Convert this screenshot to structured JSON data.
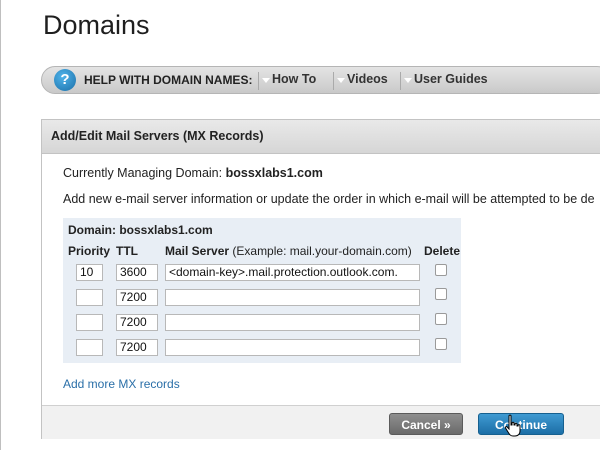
{
  "page": {
    "title": "Domains"
  },
  "help_bar": {
    "icon": "question-icon",
    "label": "HELP WITH DOMAIN NAMES:",
    "links": [
      "How To",
      "Videos",
      "User Guides"
    ]
  },
  "panel": {
    "title": "Add/Edit Mail Servers (MX Records)",
    "managing_prefix": "Currently Managing Domain:",
    "managing_domain": "bossxlabs1.com",
    "instructions": "Add new e-mail server information or update the order in which e-mail will be attempted to be de",
    "domain_label": "Domain: bossxlabs1.com",
    "columns": {
      "priority": "Priority",
      "ttl": "TTL",
      "mail_server": "Mail Server",
      "mail_server_example": "(Example: mail.your-domain.com)",
      "delete": "Delete"
    },
    "rows": [
      {
        "priority": "10",
        "ttl": "3600",
        "mail_server": "<domain-key>.mail.protection.outlook.com.",
        "delete": false
      },
      {
        "priority": "",
        "ttl": "7200",
        "mail_server": "",
        "delete": false
      },
      {
        "priority": "",
        "ttl": "7200",
        "mail_server": "",
        "delete": false
      },
      {
        "priority": "",
        "ttl": "7200",
        "mail_server": "",
        "delete": false
      }
    ],
    "add_more_link": "Add more MX records",
    "cancel_label": "Cancel »",
    "continue_label": "Continue"
  },
  "colors": {
    "accent_blue": "#1c6ea6",
    "link_blue": "#2a6fa8",
    "table_bg": "#e8eef5"
  }
}
